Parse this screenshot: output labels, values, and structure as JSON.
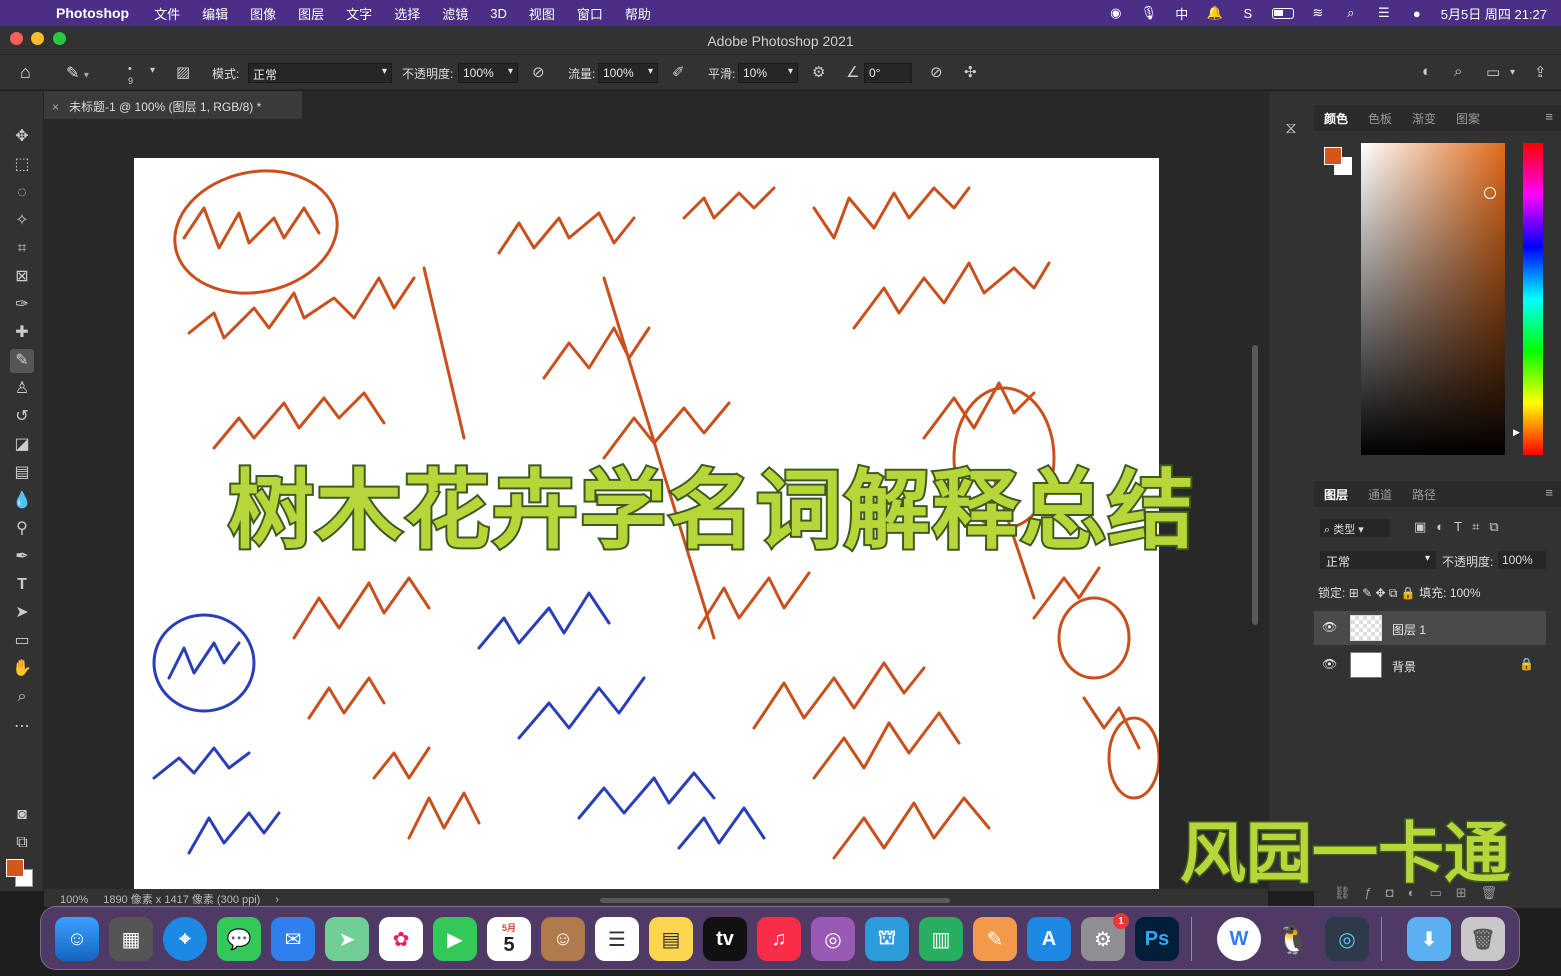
{
  "menubar": {
    "app_name": "Photoshop",
    "items": [
      "文件",
      "编辑",
      "图像",
      "图层",
      "文字",
      "选择",
      "滤镜",
      "3D",
      "视图",
      "窗口",
      "帮助"
    ],
    "datetime": "5月5日 周四 21:27",
    "status_icons": [
      "avatar-icon",
      "mic-icon",
      "input-method-icon",
      "notification-icon",
      "s-icon",
      "battery-icon",
      "wifi-icon",
      "search-icon",
      "control-center-icon",
      "siri-icon"
    ]
  },
  "window": {
    "title": "Adobe Photoshop 2021"
  },
  "options": {
    "brush_size": "9",
    "mode_label": "模式:",
    "mode_value": "正常",
    "opacity_label": "不透明度:",
    "opacity_value": "100%",
    "flow_label": "流量:",
    "flow_value": "100%",
    "smooth_label": "平滑:",
    "smooth_value": "10%",
    "angle_value": "0°"
  },
  "document": {
    "tab_title": "未标题-1 @ 100% (图层 1, RGB/8) *",
    "zoom": "100%",
    "info": "1890 像素 x 1417 像素 (300 ppi)"
  },
  "panels": {
    "color_tabs": [
      "颜色",
      "色板",
      "渐变",
      "图案"
    ],
    "layer_tabs": [
      "图层",
      "通道",
      "路径"
    ],
    "filter_label": "类型",
    "blend_mode": "正常",
    "opacity_label": "不透明度:",
    "opacity_value": "100%",
    "lock_label": "锁定:",
    "fill_label": "填充:",
    "fill_value": "100%",
    "layers": [
      {
        "name": "图层 1",
        "selected": true
      },
      {
        "name": "背景",
        "selected": false
      }
    ]
  },
  "overlay": {
    "title": "树木花卉学名词解释总结",
    "brand": "风园一卡通"
  },
  "colors": {
    "foreground": "#d4561c",
    "overlay_text": "#b7d63a",
    "menubar": "#4b2f86"
  },
  "dock": {
    "calendar_month": "5月",
    "calendar_day": "5",
    "ps_label": "Ps",
    "tv_label": "tv",
    "settings_badge": "1"
  }
}
